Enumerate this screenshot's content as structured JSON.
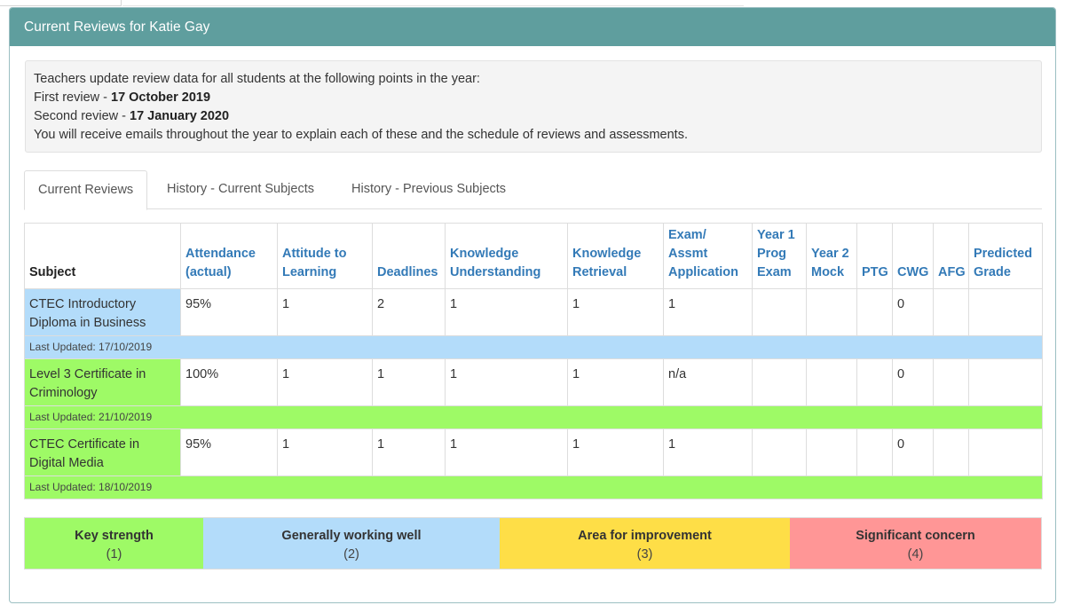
{
  "panel": {
    "title": "Current Reviews for Katie Gay"
  },
  "info": {
    "line1": "Teachers update review data for all students at the following points in the year:",
    "first_label": "First review - ",
    "first_date": "17 October 2019",
    "second_label": "Second review - ",
    "second_date": "17 January 2020",
    "line4": "You will receive emails throughout the year to explain each of these and the schedule of reviews and assessments."
  },
  "tabs": [
    {
      "label": "Current Reviews",
      "active": true
    },
    {
      "label": "History - Current Subjects",
      "active": false
    },
    {
      "label": "History - Previous Subjects",
      "active": false
    }
  ],
  "table": {
    "headers": [
      "Subject",
      "Attendance (actual)",
      "Attitude to Learning",
      "Deadlines",
      "Knowledge Understanding",
      "Knowledge Retrieval",
      "Exam/ Assmt Application",
      "Year 1 Prog Exam",
      "Year 2 Mock",
      "PTG",
      "CWG",
      "AFG",
      "Predicted Grade"
    ],
    "rows": [
      {
        "cells": [
          "CTEC Introductory Diploma in Business",
          "95%",
          "1",
          "2",
          "1",
          "1",
          "1",
          "",
          "",
          "",
          "0",
          "",
          ""
        ],
        "updated": "Last Updated: 17/10/2019",
        "color": "#b3dcfa"
      },
      {
        "cells": [
          "Level 3 Certificate in Criminology",
          "100%",
          "1",
          "1",
          "1",
          "1",
          "n/a",
          "",
          "",
          "",
          "0",
          "",
          ""
        ],
        "updated": "Last Updated: 21/10/2019",
        "color": "#9efa66"
      },
      {
        "cells": [
          "CTEC Certificate in Digital Media",
          "95%",
          "1",
          "1",
          "1",
          "1",
          "1",
          "",
          "",
          "",
          "0",
          "",
          ""
        ],
        "updated": "Last Updated: 18/10/2019",
        "color": "#9efa66"
      }
    ]
  },
  "legend": [
    {
      "title": "Key strength",
      "num": "(1)",
      "color": "#9efa66"
    },
    {
      "title": "Generally working well",
      "num": "(2)",
      "color": "#b3dcfa"
    },
    {
      "title": "Area for improvement",
      "num": "(3)",
      "color": "#fede47"
    },
    {
      "title": "Significant concern",
      "num": "(4)",
      "color": "#ff9696"
    }
  ]
}
